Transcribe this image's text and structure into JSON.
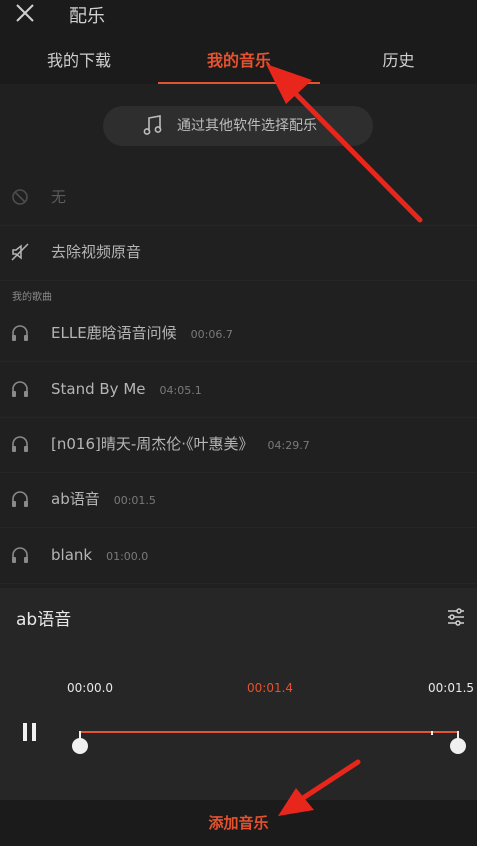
{
  "header": {
    "title": "配乐",
    "close_icon": "close-icon"
  },
  "tabs": [
    {
      "label": "我的下载",
      "active": false
    },
    {
      "label": "我的音乐",
      "active": true
    },
    {
      "label": "历史",
      "active": false
    }
  ],
  "pick_button": {
    "label": "通过其他软件选择配乐",
    "icon": "music-note-icon"
  },
  "options": {
    "none_label": "无",
    "remove_original_label": "去除视频原音"
  },
  "section_label": "我的歌曲",
  "songs": [
    {
      "name": "ELLE鹿晗语音问候",
      "duration": "00:06.7"
    },
    {
      "name": "Stand By Me",
      "duration": "04:05.1"
    },
    {
      "name": "[n016]晴天-周杰伦·《叶惠美》",
      "duration": "04:29.7"
    },
    {
      "name": "ab语音",
      "duration": "00:01.5"
    },
    {
      "name": "blank",
      "duration": "01:00.0"
    }
  ],
  "player": {
    "song": "ab语音",
    "start_time": "00:00.0",
    "current_time": "00:01.4",
    "end_time": "00:01.5",
    "progress": 0.93
  },
  "add_button": {
    "label": "添加音乐"
  },
  "colors": {
    "accent": "#e4522f",
    "background": "#1b1b1b",
    "annotation_arrow": "#e8261c"
  }
}
